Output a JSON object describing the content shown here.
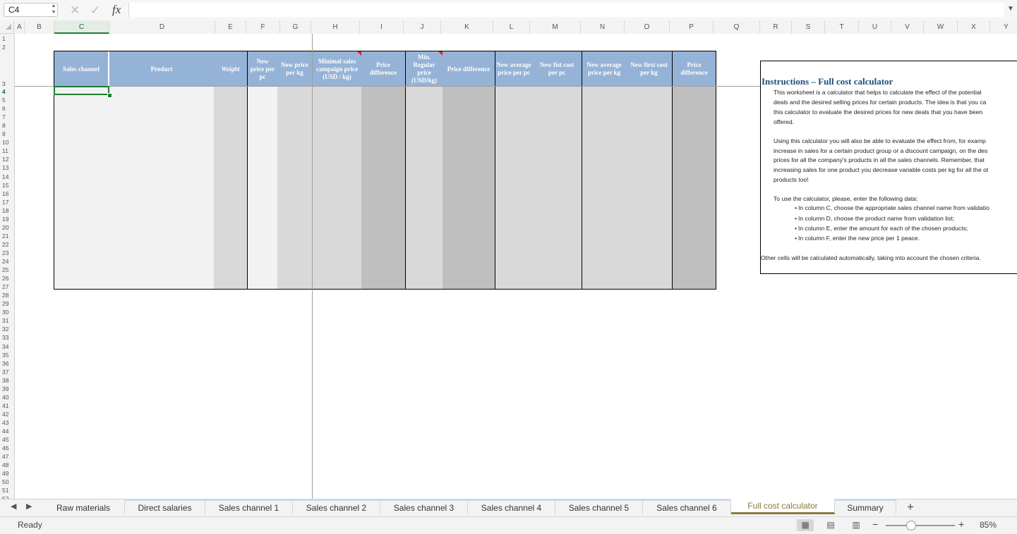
{
  "formula_bar": {
    "name_box": "C4",
    "fx": "fx",
    "content": ""
  },
  "columns": [
    "A",
    "B",
    "C",
    "D",
    "E",
    "F",
    "G",
    "H",
    "I",
    "J",
    "K",
    "L",
    "M",
    "N",
    "O",
    "P",
    "Q",
    "R",
    "S",
    "T",
    "U",
    "V",
    "W",
    "X",
    "Y"
  ],
  "rows": [
    "1",
    "2",
    "3",
    "4",
    "5",
    "6",
    "7",
    "8",
    "9",
    "10",
    "11",
    "12",
    "13",
    "14",
    "15",
    "16",
    "17",
    "18",
    "19",
    "20",
    "21",
    "22",
    "23",
    "24",
    "25",
    "26",
    "27",
    "28",
    "29",
    "30",
    "31",
    "32",
    "33",
    "34",
    "35",
    "36",
    "37",
    "38",
    "39",
    "40",
    "41",
    "42",
    "43",
    "44",
    "45",
    "46",
    "47",
    "48",
    "49",
    "50",
    "51",
    "52"
  ],
  "selected_cell": "C4",
  "table_headers": {
    "sales_channel": "Sales channel",
    "product": "Product",
    "weight": "Weight",
    "new_price_pc": "New price per pc",
    "new_price_kg": "New price per kg",
    "min_campaign_price": "Minimal sales campaign price (USD / kg)",
    "price_diff_1": "Price difference",
    "min_regular_price": "Min. Regular price (USD/kg)",
    "price_diff_2": "Price difference",
    "new_avg_price_pc": "New average price per pc",
    "new_first_cost_pc": "New fist cost per pc",
    "new_avg_price_kg": "New average price per kg",
    "new_first_cost_kg": "New first cost per kg",
    "price_diff_3": "Price difference"
  },
  "instructions": {
    "title": "Instructions – Full cost calculator",
    "para1": [
      "This worksheet is a calculator that helps to calculate the effect of the potential",
      "deals and the desired selling prices for certain products. The idea is that you ca",
      "this calculator to evaluate the desired prices for new deals that you have been",
      "offered."
    ],
    "para2": [
      "Using this calculator you will also be able to evaluate the effect from, for examp",
      "increase in sales for a certain product group or a discount campaign, on the des",
      "prices for all the company's products in all the sales channels. Remember, that",
      "increasing sales for one product you decrease variable costs per kg for all the ot",
      "products too!"
    ],
    "para3": "To use the calculator, please, enter the following data:",
    "bullets": [
      "In column C, choose the appropriate sales channel name from validatio",
      "In column D, choose the product name from validation list;",
      "In column E, enter the amount for each of the chosen products;",
      "In column F, enter the new price per 1 peace."
    ],
    "closing": "Other cells will be calculated automatically, taking into account the chosen criteria."
  },
  "sheet_tabs": [
    {
      "label": "Raw materials",
      "active": false
    },
    {
      "label": "Direct salaries",
      "active": false
    },
    {
      "label": "Sales channel 1",
      "active": false
    },
    {
      "label": "Sales channel 2",
      "active": false
    },
    {
      "label": "Sales channel 3",
      "active": false
    },
    {
      "label": "Sales channel 4",
      "active": false
    },
    {
      "label": "Sales channel 5",
      "active": false
    },
    {
      "label": "Sales channel 6",
      "active": false
    },
    {
      "label": "Full cost calculator",
      "active": true
    },
    {
      "label": "Summary",
      "active": false
    }
  ],
  "status": {
    "text": "Ready",
    "zoom": "85%",
    "zoom_fraction": 0.36
  },
  "colors": {
    "header_blue": "#95b3d7",
    "selection_green": "#1e7e34",
    "active_tab": "#8b7a3d"
  }
}
